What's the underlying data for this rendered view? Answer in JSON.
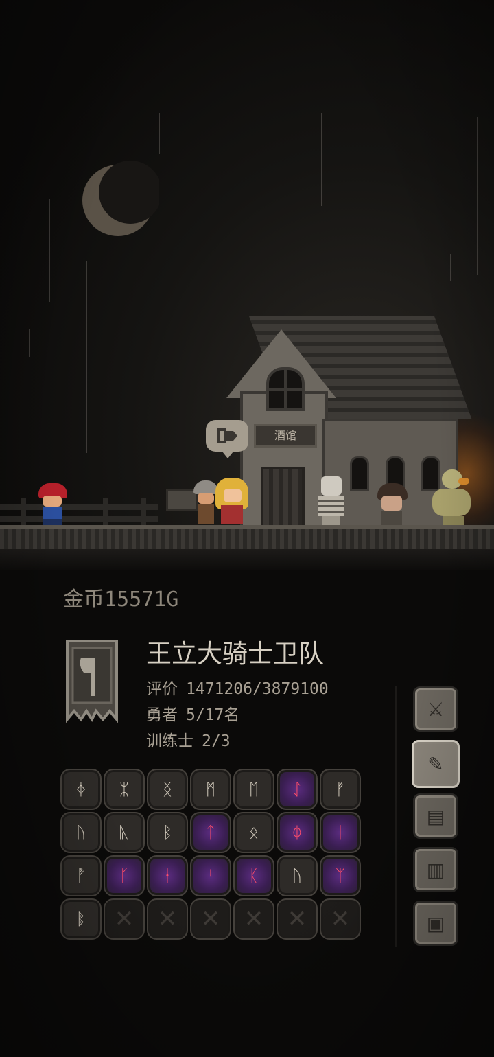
{
  "scene": {
    "tavern_sign": "酒馆",
    "bubble_icon": "enter-door-icon"
  },
  "panel": {
    "gold": "金币15571G",
    "guild_name": "王立大骑士卫队",
    "stats": [
      {
        "label": "评价",
        "value": "1471206/3879100"
      },
      {
        "label": "勇者",
        "value": "5/17名"
      },
      {
        "label": "训练士",
        "value": "2/3"
      }
    ]
  },
  "runes": [
    {
      "glyph": "ᛄ",
      "type": "stone"
    },
    {
      "glyph": "ᛯ",
      "type": "stone"
    },
    {
      "glyph": "ᛝ",
      "type": "stone"
    },
    {
      "glyph": "ᛗ",
      "type": "stone"
    },
    {
      "glyph": "ᛖ",
      "type": "stone"
    },
    {
      "glyph": "ᛇ",
      "type": "magic"
    },
    {
      "glyph": "ᚠ",
      "type": "stone"
    },
    {
      "glyph": "ᚢ",
      "type": "stone"
    },
    {
      "glyph": "ᚣ",
      "type": "stone"
    },
    {
      "glyph": "ᛒ",
      "type": "stone"
    },
    {
      "glyph": "ᛏ",
      "type": "magic"
    },
    {
      "glyph": "ᛟ",
      "type": "stone"
    },
    {
      "glyph": "ᛰ",
      "type": "magic"
    },
    {
      "glyph": "ᛁ",
      "type": "magic"
    },
    {
      "glyph": "ᚡ",
      "type": "stone"
    },
    {
      "glyph": "ᚴ",
      "type": "magic"
    },
    {
      "glyph": "ᛂ",
      "type": "magic"
    },
    {
      "glyph": "ᛌ",
      "type": "magic"
    },
    {
      "glyph": "ᛕ",
      "type": "magic"
    },
    {
      "glyph": "ᚢ",
      "type": "stone"
    },
    {
      "glyph": "ᛉ",
      "type": "magic"
    },
    {
      "glyph": "ᛔ",
      "type": "stone"
    },
    {
      "glyph": "✕",
      "type": "empty"
    },
    {
      "glyph": "✕",
      "type": "empty"
    },
    {
      "glyph": "✕",
      "type": "empty"
    },
    {
      "glyph": "✕",
      "type": "empty"
    },
    {
      "glyph": "✕",
      "type": "empty"
    },
    {
      "glyph": "✕",
      "type": "empty"
    }
  ],
  "side_menu": [
    {
      "icon": "crossed-swords-icon",
      "glyph": "⚔",
      "active": false
    },
    {
      "icon": "quill-scroll-icon",
      "glyph": "✎",
      "active": true
    },
    {
      "icon": "map-scroll-icon",
      "glyph": "▤",
      "active": false
    },
    {
      "icon": "document-icon",
      "glyph": "▥",
      "active": false
    },
    {
      "icon": "computer-icon",
      "glyph": "▣",
      "active": false
    }
  ],
  "colors": {
    "magic_rune_bg": "#5b2c80",
    "magic_rune_glyph": "#ff4d6a",
    "stone_rune_bg": "#2e2b28"
  }
}
